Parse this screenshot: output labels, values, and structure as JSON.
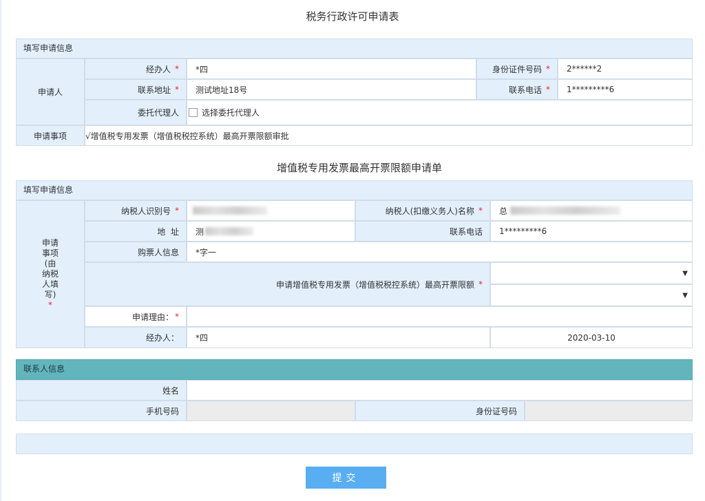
{
  "page": {
    "title": "税务行政许可申请表",
    "subtitle": "增值税专用发票最高开票限额申请单"
  },
  "section1": {
    "header": "填写申请信息",
    "applicant_label": "申请人",
    "handler_label": "经办人",
    "handler_value": "*四",
    "id_label": "身份证件号码",
    "id_value": "2******2",
    "address_label": "联系地址",
    "address_value": "测试地址18号",
    "phone_label": "联系电话",
    "phone_value": "1*********6",
    "agent_label": "委托代理人",
    "agent_checkbox_text": "选择委托代理人",
    "matter_label": "申请事项",
    "matter_value": "√增值税专用发票（增值税税控系统）最高开票限额审批"
  },
  "section2": {
    "header": "填写申请信息",
    "side_label": "申请事项(由纳税人填写)",
    "side_lines": [
      "申请",
      "事项",
      "(由",
      "纳税",
      "人填",
      "写)",
      "*"
    ],
    "taxpayer_id_label": "纳税人识别号",
    "taxpayer_name_label": "纳税人(扣缴义务人)名称",
    "taxpayer_name_prefix": "总",
    "address_label": "地  址",
    "address_prefix": "测",
    "phone_label": "联系电话",
    "phone_value": "1*********6",
    "buyer_label": "购票人信息",
    "buyer_value": "*字一",
    "limit_label": "申请增值税专用发票（增值税税控系统）最高开票限额",
    "reason_label": "申请理由：",
    "handler_label": "经办人：",
    "handler_value": "*四",
    "date_value": "2020-03-10",
    "select_arrow": "▼"
  },
  "contact": {
    "header": "联系人信息",
    "name_label": "姓名",
    "mobile_label": "手机号码",
    "idcard_label": "身份证号码"
  },
  "submit_label": "提交",
  "required_mark": "*"
}
